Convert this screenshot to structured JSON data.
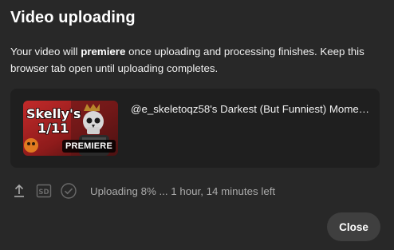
{
  "dialog": {
    "title": "Video uploading",
    "description_before": "Your video will ",
    "description_emphasis": "premiere",
    "description_after": " once uploading and processing finishes. Keep this browser tab open until uploading completes."
  },
  "video": {
    "title": "@e_skeletoqz58's Darkest (But Funniest) Moment...",
    "thumbnail": {
      "text_line1": "Skelly's",
      "text_line2": "1/11",
      "badge": "PREMIERE"
    }
  },
  "status": {
    "icons": [
      "upload-icon",
      "sd-icon",
      "check-circle-icon"
    ],
    "text": "Uploading 8% ... 1 hour, 14 minutes left",
    "progress_percent": 8
  },
  "actions": {
    "close_label": "Close"
  },
  "colors": {
    "background": "#282828",
    "card": "#1f1f1f",
    "button": "#3f3f3f",
    "muted_text": "#aaaaaa"
  }
}
